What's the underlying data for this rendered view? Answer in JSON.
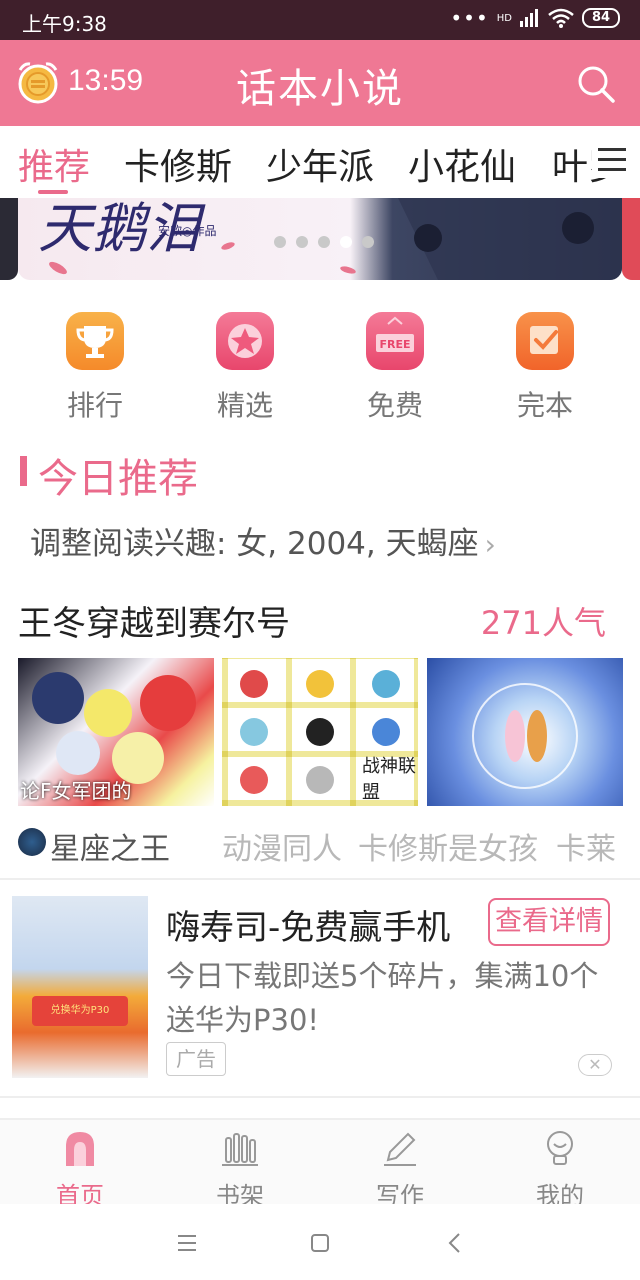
{
  "status_bar": {
    "time": "上午9:38",
    "signal": "HD",
    "battery": "84"
  },
  "header": {
    "timer": "13:59",
    "title": "话本小说",
    "icons": [
      "alarm-clock-icon",
      "search-icon"
    ]
  },
  "tabs": [
    {
      "label": "推荐",
      "active": true
    },
    {
      "label": "卡修斯"
    },
    {
      "label": "少年派"
    },
    {
      "label": "小花仙"
    },
    {
      "label": "叶罗"
    }
  ],
  "banner": {
    "title": "天鹅泪",
    "author": "安欣◎作品",
    "dots": 5,
    "active_dot": 3
  },
  "categories": [
    {
      "label": "排行",
      "icon": "trophy-icon",
      "color": "#f5a03a"
    },
    {
      "label": "精选",
      "icon": "star-icon",
      "color": "#ef5a7d"
    },
    {
      "label": "免费",
      "icon": "free-sign-icon",
      "color": "#ef5a7d",
      "badge": "FREE"
    },
    {
      "label": "完本",
      "icon": "checkbox-icon",
      "color": "#f47a3a"
    }
  ],
  "section": {
    "title": "今日推荐",
    "interest": "调整阅读兴趣: 女, 2004, 天蝎座"
  },
  "book": {
    "title": "王冬穿越到赛尔号",
    "popularity": "271人气",
    "cover1_caption": "论F女军团的",
    "cover2_caption": "战神联盟",
    "author": "星座之王",
    "tags": [
      "动漫同人",
      "卡修斯是女孩",
      "卡莱"
    ]
  },
  "ad": {
    "title": "嗨寿司-免费赢手机",
    "button": "查看详情",
    "description": "今日下载即送5个碎片，集满10个送华为P30!",
    "tag": "广告",
    "image_text": "兑换华为P30"
  },
  "bottom_nav": [
    {
      "label": "首页",
      "icon": "home-arch-icon",
      "active": true
    },
    {
      "label": "书架",
      "icon": "bookshelf-icon"
    },
    {
      "label": "写作",
      "icon": "pencil-icon"
    },
    {
      "label": "我的",
      "icon": "profile-bulb-icon"
    }
  ],
  "colors": {
    "brand": "#ef7894",
    "accent": "#ea6a8b",
    "status_bar": "#3f1f2b"
  }
}
